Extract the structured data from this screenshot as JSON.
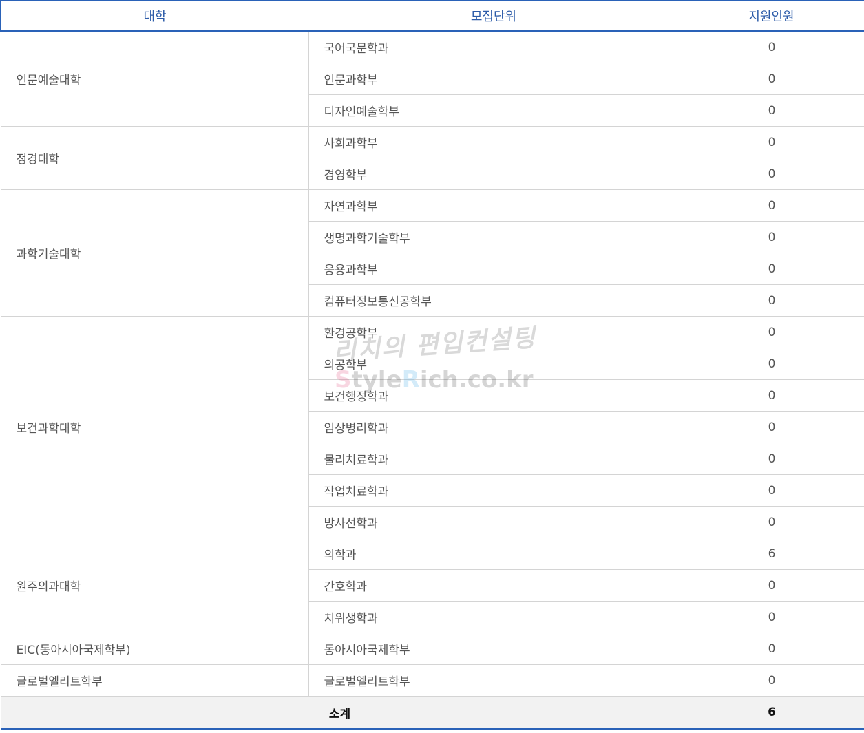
{
  "table": {
    "headers": {
      "college": "대학",
      "unit": "모집단위",
      "applicants": "지원인원"
    },
    "groups": [
      {
        "college": "인문예술대학",
        "units": [
          {
            "name": "국어국문학과",
            "count": "0"
          },
          {
            "name": "인문과학부",
            "count": "0"
          },
          {
            "name": "디자인예술학부",
            "count": "0"
          }
        ]
      },
      {
        "college": "정경대학",
        "units": [
          {
            "name": "사회과학부",
            "count": "0"
          },
          {
            "name": "경영학부",
            "count": "0"
          }
        ]
      },
      {
        "college": "과학기술대학",
        "units": [
          {
            "name": "자연과학부",
            "count": "0"
          },
          {
            "name": "생명과학기술학부",
            "count": "0"
          },
          {
            "name": "응용과학부",
            "count": "0"
          },
          {
            "name": "컴퓨터정보통신공학부",
            "count": "0"
          }
        ]
      },
      {
        "college": "보건과학대학",
        "units": [
          {
            "name": "환경공학부",
            "count": "0"
          },
          {
            "name": "의공학부",
            "count": "0"
          },
          {
            "name": "보건행정학과",
            "count": "0"
          },
          {
            "name": "임상병리학과",
            "count": "0"
          },
          {
            "name": "물리치료학과",
            "count": "0"
          },
          {
            "name": "작업치료학과",
            "count": "0"
          },
          {
            "name": "방사선학과",
            "count": "0"
          }
        ]
      },
      {
        "college": "원주의과대학",
        "units": [
          {
            "name": "의학과",
            "count": "6"
          },
          {
            "name": "간호학과",
            "count": "0"
          },
          {
            "name": "치위생학과",
            "count": "0"
          }
        ]
      },
      {
        "college": "EIC(동아시아국제학부)",
        "units": [
          {
            "name": "동아시아국제학부",
            "count": "0"
          }
        ]
      },
      {
        "college": "글로벌엘리트학부",
        "units": [
          {
            "name": "글로벌엘리트학부",
            "count": "0"
          }
        ]
      }
    ],
    "total": {
      "label": "소계",
      "count": "6"
    }
  },
  "watermark": {
    "line1": "리치의 편입컨설팅",
    "brand_s": "S",
    "brand_tyle": "tyle",
    "brand_r": "R",
    "brand_rest": "ich.co.kr"
  },
  "colors": {
    "header_text": "#2c5ba8",
    "header_border": "#2a62b8",
    "cell_border": "#d4d4d4",
    "total_bg": "#f2f2f2"
  }
}
